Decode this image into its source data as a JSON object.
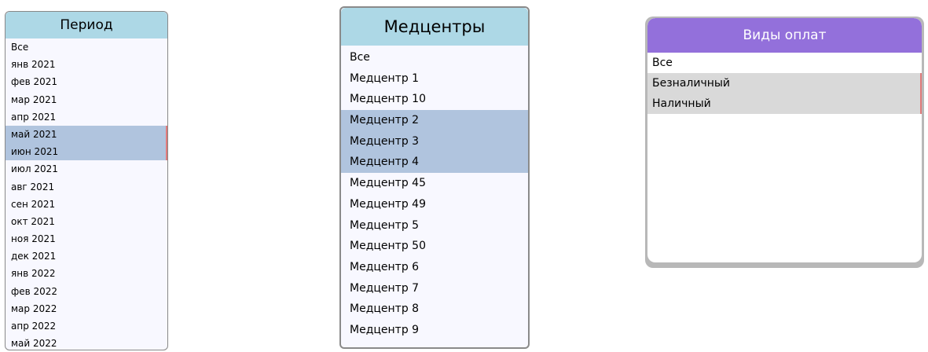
{
  "colors": {
    "period_header": "#add8e6",
    "medcenters_header": "#add8e6",
    "payment_header": "#9370db",
    "selected_blue": "#b0c4de",
    "selected_gray": "#d9d9d9",
    "scroll_marker": "#e07b7b"
  },
  "period": {
    "title": "Период",
    "items": [
      {
        "label": "Все",
        "selected": false
      },
      {
        "label": "янв 2021",
        "selected": false
      },
      {
        "label": "фев 2021",
        "selected": false
      },
      {
        "label": "мар 2021",
        "selected": false
      },
      {
        "label": "апр 2021",
        "selected": false
      },
      {
        "label": "май 2021",
        "selected": true
      },
      {
        "label": "июн 2021",
        "selected": true
      },
      {
        "label": "июл 2021",
        "selected": false
      },
      {
        "label": "авг 2021",
        "selected": false
      },
      {
        "label": "сен 2021",
        "selected": false
      },
      {
        "label": "окт 2021",
        "selected": false
      },
      {
        "label": "ноя 2021",
        "selected": false
      },
      {
        "label": "дек 2021",
        "selected": false
      },
      {
        "label": "янв 2022",
        "selected": false
      },
      {
        "label": "фев 2022",
        "selected": false
      },
      {
        "label": "мар 2022",
        "selected": false
      },
      {
        "label": "апр 2022",
        "selected": false
      },
      {
        "label": "май 2022",
        "selected": false
      }
    ]
  },
  "medcenters": {
    "title": "Медцентры",
    "items": [
      {
        "label": "Все",
        "selected": false
      },
      {
        "label": "Медцентр 1",
        "selected": false
      },
      {
        "label": "Медцентр 10",
        "selected": false
      },
      {
        "label": "Медцентр 2",
        "selected": true
      },
      {
        "label": "Медцентр 3",
        "selected": true
      },
      {
        "label": "Медцентр 4",
        "selected": true
      },
      {
        "label": "Медцентр 45",
        "selected": false
      },
      {
        "label": "Медцентр 49",
        "selected": false
      },
      {
        "label": "Медцентр 5",
        "selected": false
      },
      {
        "label": "Медцентр 50",
        "selected": false
      },
      {
        "label": "Медцентр 6",
        "selected": false
      },
      {
        "label": "Медцентр 7",
        "selected": false
      },
      {
        "label": "Медцентр 8",
        "selected": false
      },
      {
        "label": "Медцентр 9",
        "selected": false
      }
    ]
  },
  "payment_types": {
    "title": "Виды оплат",
    "items": [
      {
        "label": "Все",
        "selected": false
      },
      {
        "label": "Безналичный",
        "selected": true
      },
      {
        "label": "Наличный",
        "selected": true
      }
    ]
  }
}
